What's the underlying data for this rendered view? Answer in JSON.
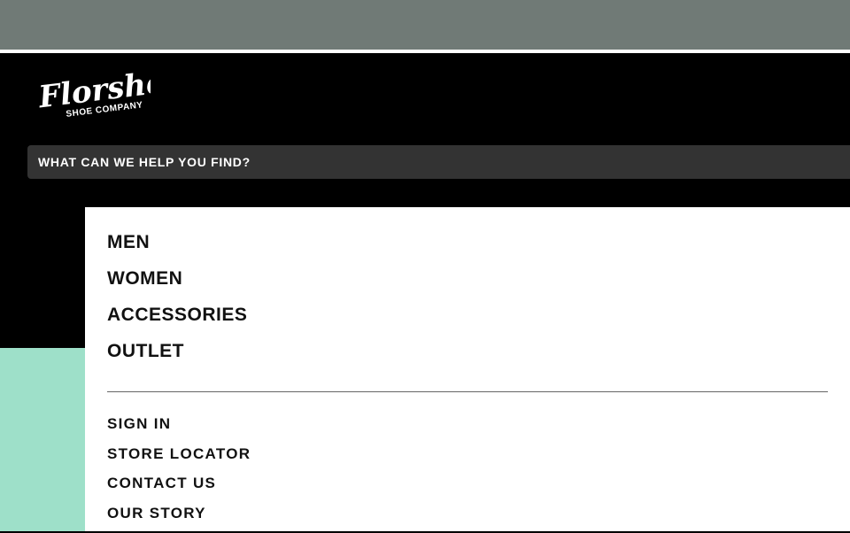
{
  "brand": {
    "name": "Florsheim",
    "tagline": "SHOE COMPANY"
  },
  "search": {
    "placeholder": "WHAT CAN WE HELP YOU FIND?"
  },
  "primary_nav": {
    "items": [
      {
        "label": "MEN"
      },
      {
        "label": "WOMEN"
      },
      {
        "label": "ACCESSORIES"
      },
      {
        "label": "OUTLET"
      }
    ]
  },
  "secondary_nav": {
    "items": [
      {
        "label": "SIGN IN"
      },
      {
        "label": "STORE LOCATOR"
      },
      {
        "label": "CONTACT US"
      },
      {
        "label": "OUR STORY"
      }
    ]
  },
  "colors": {
    "overlay": "#707a76",
    "header_bg": "#000000",
    "search_bg": "#333333",
    "accent_mint": "#9ee0c9",
    "panel_bg": "#ffffff",
    "text_dark": "#111111"
  }
}
